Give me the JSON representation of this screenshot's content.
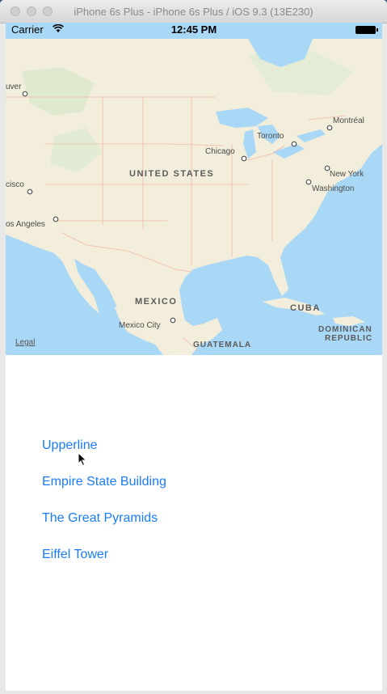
{
  "window": {
    "title": "iPhone 6s Plus - iPhone 6s Plus / iOS 9.3 (13E230)"
  },
  "status_bar": {
    "carrier": "Carrier",
    "time": "12:45 PM"
  },
  "map": {
    "labels": {
      "vancouver": "uver",
      "montreal": "Montréal",
      "chicago": "Chicago",
      "toronto": "Toronto",
      "new_york": "New York",
      "washington": "Washington",
      "san_francisco": "cisco",
      "los_angeles": "os Angeles",
      "mexico_city": "Mexico City"
    },
    "countries": {
      "united_states": "UNITED STATES",
      "mexico": "MEXICO",
      "cuba": "CUBA",
      "dominican_1": "DOMINICAN",
      "dominican_2": "REPUBLIC",
      "guatemala": "GUATEMALA"
    },
    "legal": "Legal"
  },
  "links": [
    "Upperline",
    "Empire State Building",
    "The Great Pyramids",
    "Eiffel Tower"
  ],
  "colors": {
    "link": "#1a7cf2",
    "land": "#f3eedb",
    "water": "#a8d8f5",
    "border": "#f0b8a6"
  }
}
